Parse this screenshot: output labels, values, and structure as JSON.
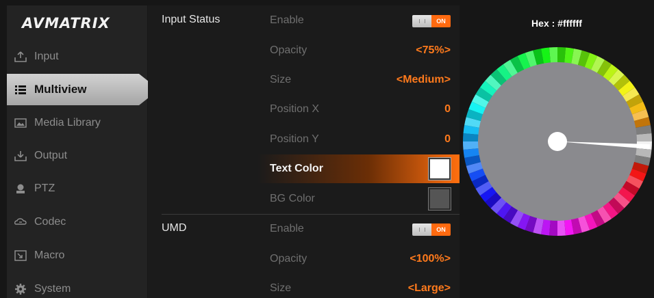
{
  "brand": "AVMATRIX",
  "sidebar": {
    "items": [
      {
        "label": "Input",
        "icon": "upload-icon"
      },
      {
        "label": "Multiview",
        "icon": "list-icon"
      },
      {
        "label": "Media Library",
        "icon": "image-icon"
      },
      {
        "label": "Output",
        "icon": "download-icon"
      },
      {
        "label": "PTZ",
        "icon": "camera-icon"
      },
      {
        "label": "Codec",
        "icon": "codec-icon"
      },
      {
        "label": "Macro",
        "icon": "macro-icon"
      },
      {
        "label": "System",
        "icon": "gear-icon"
      }
    ],
    "active": "Multiview"
  },
  "input_status": {
    "group_label": "Input Status",
    "enable": {
      "label": "Enable",
      "toggle_text": "ON",
      "state": "on"
    },
    "opacity": {
      "label": "Opacity",
      "value": "<75%>"
    },
    "size": {
      "label": "Size",
      "value": "<Medium>"
    },
    "position_x": {
      "label": "Position X",
      "value": "0"
    },
    "position_y": {
      "label": "Position Y",
      "value": "0"
    },
    "text_color": {
      "label": "Text Color",
      "swatch": "#ffffff"
    },
    "bg_color": {
      "label": "BG Color",
      "swatch": "#555555"
    }
  },
  "umd": {
    "group_label": "UMD",
    "enable": {
      "label": "Enable",
      "toggle_text": "ON",
      "state": "on"
    },
    "opacity": {
      "label": "Opacity",
      "value": "<100%>"
    },
    "size": {
      "label": "Size",
      "value": "<Large>"
    }
  },
  "color_picker": {
    "hex_label": "Hex : #ffffff",
    "selected": "#ffffff"
  },
  "colors": {
    "accent": "#ff7a1c",
    "toggle_on": "#ff6a10",
    "wheel_center": "#8a8a8e"
  }
}
